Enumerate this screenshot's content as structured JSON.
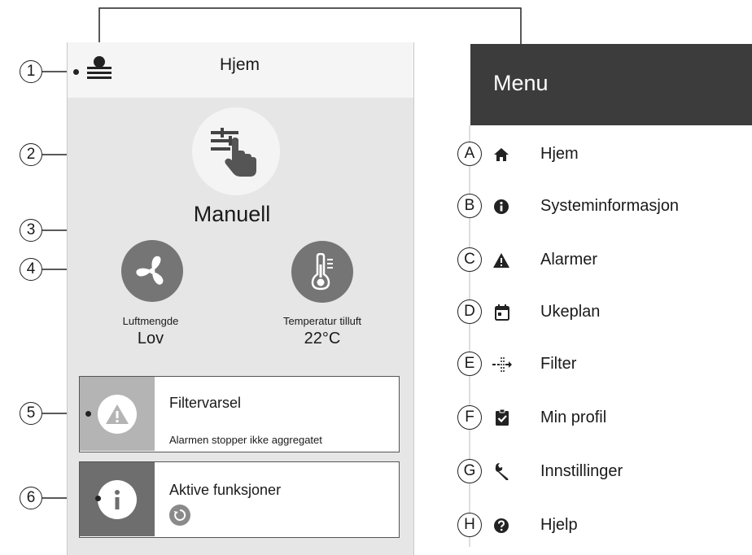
{
  "screen": {
    "header": {
      "title": "Hjem"
    },
    "mode": {
      "label": "Manuell"
    },
    "airflow": {
      "label": "Luftmengde",
      "value": "Lov"
    },
    "temperature": {
      "label": "Temperatur tilluft",
      "value": "22°C"
    },
    "filter_card": {
      "title": "Filtervarsel",
      "subtitle": "Alarmen stopper ikke aggregatet"
    },
    "functions_card": {
      "title": "Aktive funksjoner"
    }
  },
  "callouts": [
    "1",
    "2",
    "3",
    "4",
    "5",
    "6"
  ],
  "menu": {
    "title": "Menu",
    "items": [
      {
        "letter": "A",
        "label": "Hjem",
        "icon": "home-icon"
      },
      {
        "letter": "B",
        "label": "Systeminformasjon",
        "icon": "info-icon"
      },
      {
        "letter": "C",
        "label": "Alarmer",
        "icon": "warning-icon"
      },
      {
        "letter": "D",
        "label": "Ukeplan",
        "icon": "calendar-icon"
      },
      {
        "letter": "E",
        "label": "Filter",
        "icon": "filter-icon"
      },
      {
        "letter": "F",
        "label": "Min profil",
        "icon": "clipboard-check-icon"
      },
      {
        "letter": "G",
        "label": "Innstillinger",
        "icon": "wrench-icon"
      },
      {
        "letter": "H",
        "label": "Hjelp",
        "icon": "help-icon"
      }
    ]
  },
  "colors": {
    "menu_header": "#3c3c3c",
    "panel": "#e6e6e6",
    "icon_dark": "#757575"
  }
}
